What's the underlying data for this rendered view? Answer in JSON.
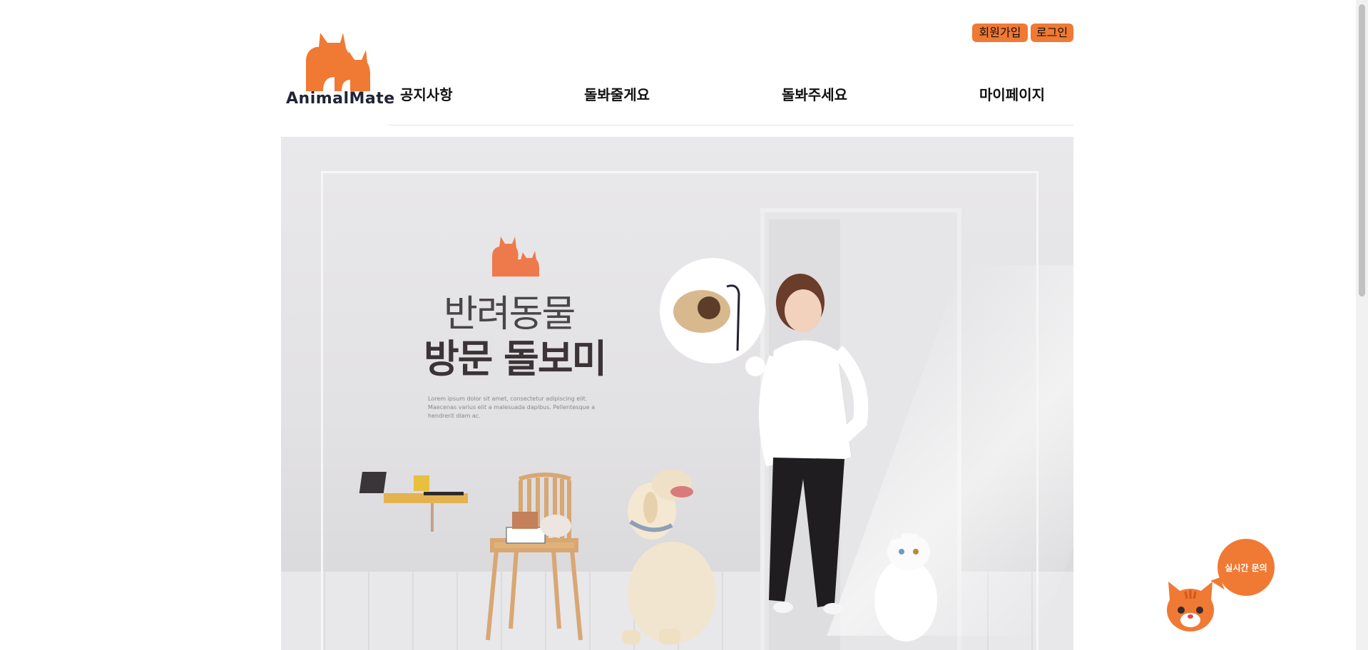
{
  "header": {
    "logo_text": "AnimalMate",
    "auth": {
      "signup_label": "회원가입",
      "login_label": "로그인"
    },
    "nav": [
      "공지사항",
      "돌봐줄게요",
      "돌봐주세요",
      "마이페이지"
    ]
  },
  "hero": {
    "title_line1": "반려동물",
    "title_line2": "방문 돌보미",
    "lorem": "Lorem ipsum dolor sit amet, consectetur adipiscing elit. Maecenas varius elit a malesuada dapibus. Pellentesque a hendrerit diam ac."
  },
  "chat": {
    "label": "실시간 문의"
  },
  "colors": {
    "accent": "#f07934",
    "logo_text": "#232338"
  },
  "icons": {
    "logo": "dog-and-cat-logo-icon",
    "chat": "cat-face-icon"
  }
}
